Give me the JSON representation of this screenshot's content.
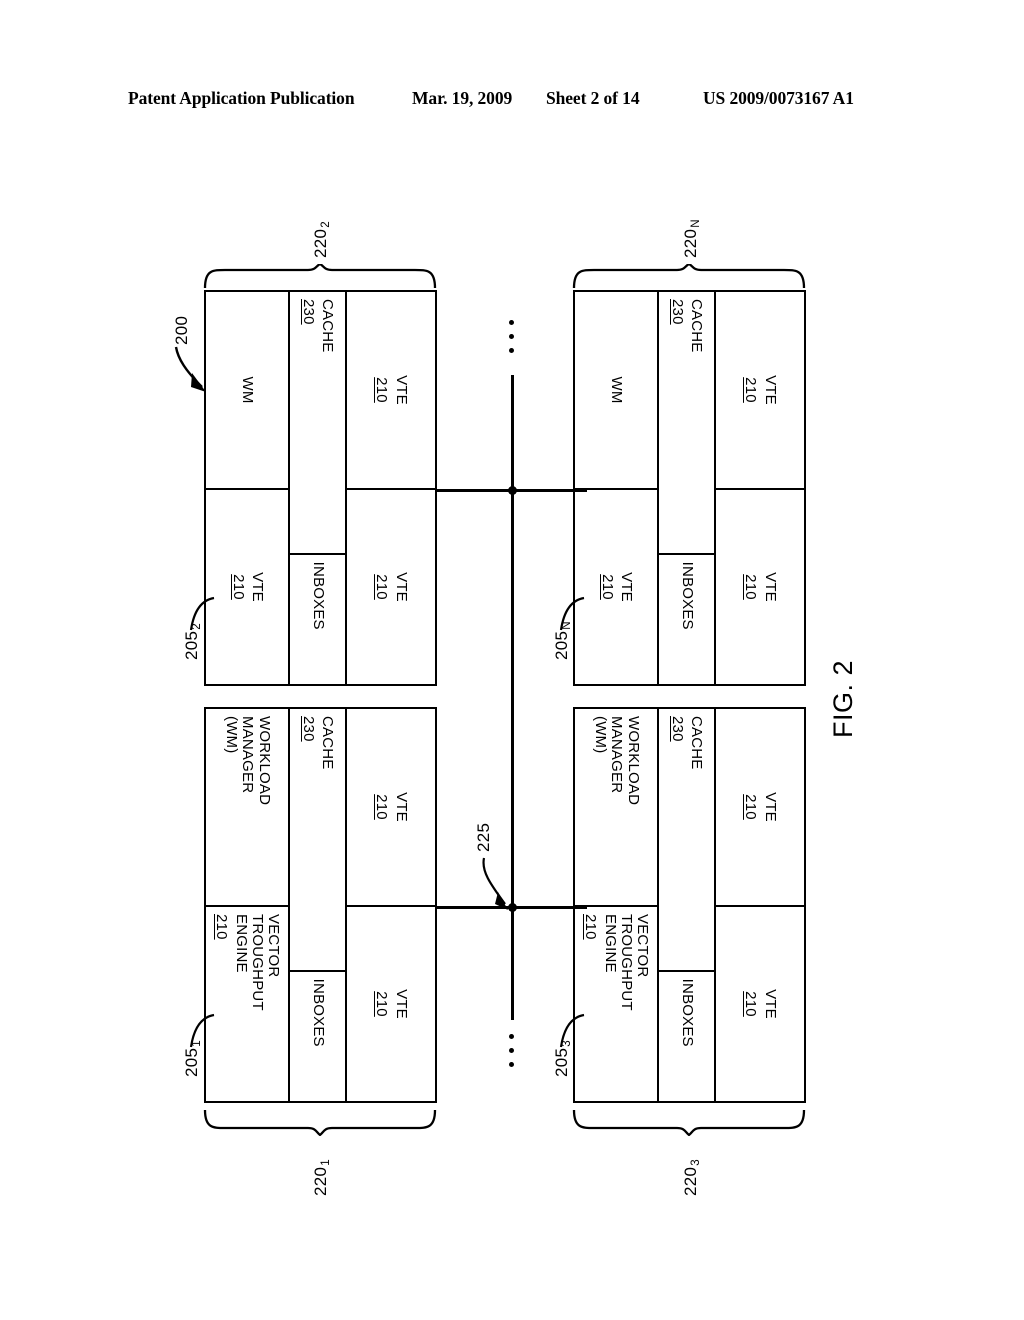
{
  "header": {
    "publication": "Patent Application Publication",
    "date": "Mar. 19, 2009",
    "sheet": "Sheet 2 of 14",
    "patent_number": "US 2009/0073167 A1"
  },
  "figure": {
    "label": "FIG. 2",
    "system_ref": "200",
    "bus_ref": "225"
  },
  "cells": {
    "workload_manager_full": "WORKLOAD\nMANAGER\n(WM)",
    "workload_manager_short": "WM",
    "vector_throughput_engine_full": "VECTOR\nTROUGHPUT\nENGINE",
    "vector_throughput_engine_short": "VTE",
    "vte_num": "210",
    "cache": "CACHE",
    "cache_num": "230",
    "inboxes": "INBOXES"
  },
  "blocks": [
    {
      "id": "block-205-1",
      "core_ref": "205",
      "core_sub": "1",
      "group_ref": "220",
      "group_sub": "1",
      "wm_label": "WORKLOAD\nMANAGER\n(WM)",
      "vte_bottom_label": "VECTOR\nTROUGHPUT\nENGINE",
      "vte_bottom_num": "210",
      "vte_top_left_label": "VTE",
      "vte_top_left_num": "210",
      "vte_top_right_label": "VTE",
      "vte_top_right_num": "210",
      "cache_label": "CACHE",
      "cache_num": "230",
      "inboxes_label": "INBOXES"
    },
    {
      "id": "block-205-2",
      "core_ref": "205",
      "core_sub": "2",
      "group_ref": "220",
      "group_sub": "2",
      "wm_label": "WM",
      "vte_bottom_label": "VTE",
      "vte_bottom_num": "210",
      "vte_top_left_label": "VTE",
      "vte_top_left_num": "210",
      "vte_top_right_label": "VTE",
      "vte_top_right_num": "210",
      "cache_label": "CACHE",
      "cache_num": "230",
      "inboxes_label": "INBOXES"
    },
    {
      "id": "block-205-3",
      "core_ref": "205",
      "core_sub": "3",
      "group_ref": "220",
      "group_sub": "3",
      "wm_label": "WORKLOAD\nMANAGER\n(WM)",
      "vte_bottom_label": "VECTOR\nTROUGHPUT\nENGINE",
      "vte_bottom_num": "210",
      "vte_top_left_label": "VTE",
      "vte_top_left_num": "210",
      "vte_top_right_label": "VTE",
      "vte_top_right_num": "210",
      "cache_label": "CACHE",
      "cache_num": "230",
      "inboxes_label": "INBOXES"
    },
    {
      "id": "block-205-N",
      "core_ref": "205",
      "core_sub": "N",
      "group_ref": "220",
      "group_sub": "N",
      "wm_label": "WM",
      "vte_bottom_label": "VTE",
      "vte_bottom_num": "210",
      "vte_top_left_label": "VTE",
      "vte_top_left_num": "210",
      "vte_top_right_label": "VTE",
      "vte_top_right_num": "210",
      "cache_label": "CACHE",
      "cache_num": "230",
      "inboxes_label": "INBOXES"
    }
  ]
}
